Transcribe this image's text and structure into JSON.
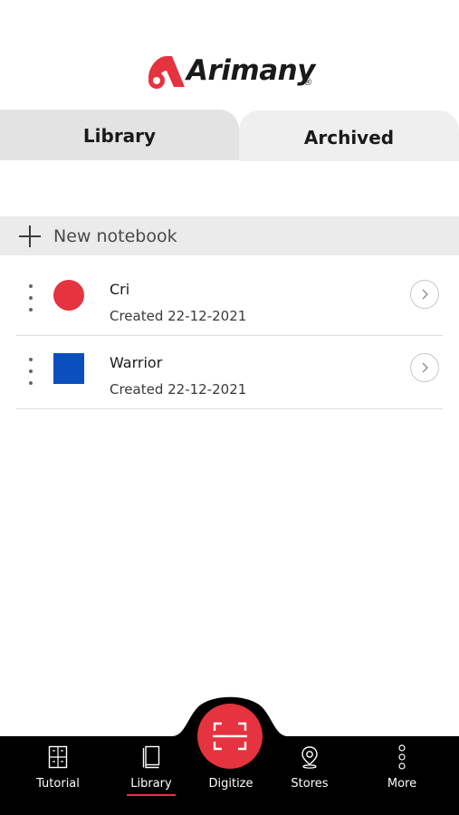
{
  "brand": {
    "name": "Arimany",
    "registered": "®",
    "accent_color": "#e5333f"
  },
  "tabs": [
    {
      "label": "Library",
      "active": true
    },
    {
      "label": "Archived",
      "active": false
    }
  ],
  "new_notebook": {
    "label": "New notebook",
    "icon": "plus-icon"
  },
  "notebooks": [
    {
      "name": "Cri",
      "created": "Created 22-12-2021",
      "color": "#e5333f",
      "shape": "circle"
    },
    {
      "name": "Warrior",
      "created": "Created 22-12-2021",
      "color": "#0a4fbd",
      "shape": "square"
    }
  ],
  "bottom_nav": {
    "items": [
      {
        "label": "Tutorial",
        "icon": "tutorial-icon",
        "active": false
      },
      {
        "label": "Library",
        "icon": "book-icon",
        "active": true
      },
      {
        "label": "Digitize",
        "icon": "scan-icon",
        "active": false
      },
      {
        "label": "Stores",
        "icon": "location-pin-icon",
        "active": false
      },
      {
        "label": "More",
        "icon": "more-vertical-icon",
        "active": false
      }
    ]
  }
}
